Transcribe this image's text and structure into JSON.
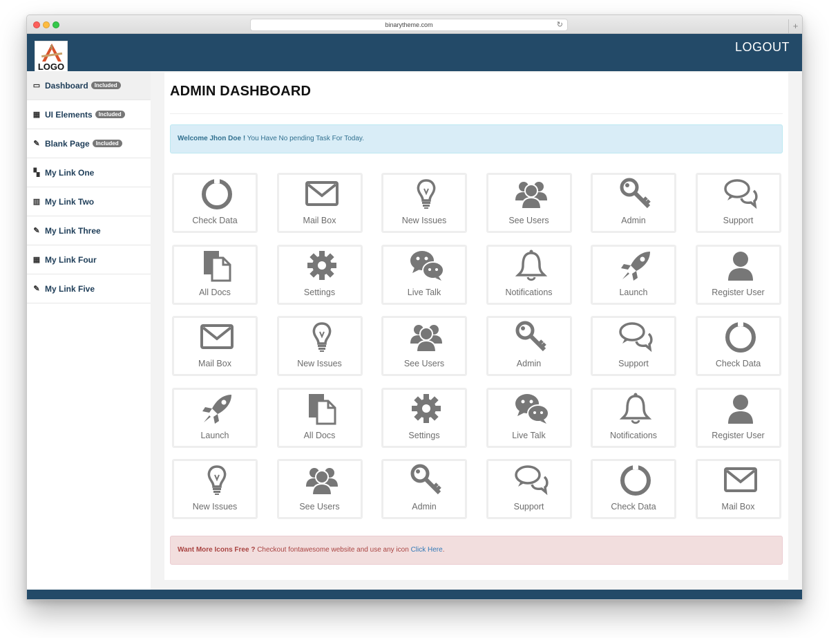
{
  "browser": {
    "url": "binarytheme.com"
  },
  "header": {
    "logo_text": "LOGO",
    "logout_label": "LOGOUT"
  },
  "sidebar": {
    "items": [
      {
        "label": "Dashboard",
        "icon": "desktop-icon",
        "glyph": "▭",
        "badge": "Included",
        "active": true
      },
      {
        "label": "UI Elements",
        "icon": "table-icon",
        "glyph": "▦",
        "badge": "Included"
      },
      {
        "label": "Blank Page",
        "icon": "edit-icon",
        "glyph": "✎",
        "badge": "Included"
      },
      {
        "label": "My Link One",
        "icon": "qrcode-icon",
        "glyph": "▚"
      },
      {
        "label": "My Link Two",
        "icon": "bar-chart-icon",
        "glyph": "▥"
      },
      {
        "label": "My Link Three",
        "icon": "edit-icon",
        "glyph": "✎"
      },
      {
        "label": "My Link Four",
        "icon": "table-icon",
        "glyph": "▦"
      },
      {
        "label": "My Link Five",
        "icon": "edit-icon",
        "glyph": "✎"
      }
    ]
  },
  "main": {
    "title": "ADMIN DASHBOARD",
    "welcome": {
      "strong": "Welcome Jhon Doe !",
      "text": "You Have No pending Task For Today."
    },
    "tiles": [
      {
        "label": "Check Data",
        "icon": "circle-notch-icon"
      },
      {
        "label": "Mail Box",
        "icon": "envelope-icon"
      },
      {
        "label": "New Issues",
        "icon": "lightbulb-icon"
      },
      {
        "label": "See Users",
        "icon": "users-icon"
      },
      {
        "label": "Admin",
        "icon": "key-icon"
      },
      {
        "label": "Support",
        "icon": "comments-icon"
      },
      {
        "label": "All Docs",
        "icon": "files-icon"
      },
      {
        "label": "Settings",
        "icon": "gear-icon"
      },
      {
        "label": "Live Talk",
        "icon": "wechat-icon"
      },
      {
        "label": "Notifications",
        "icon": "bell-icon"
      },
      {
        "label": "Launch",
        "icon": "rocket-icon"
      },
      {
        "label": "Register User",
        "icon": "user-icon"
      },
      {
        "label": "Mail Box",
        "icon": "envelope-icon"
      },
      {
        "label": "New Issues",
        "icon": "lightbulb-icon"
      },
      {
        "label": "See Users",
        "icon": "users-icon"
      },
      {
        "label": "Admin",
        "icon": "key-icon"
      },
      {
        "label": "Support",
        "icon": "comments-icon"
      },
      {
        "label": "Check Data",
        "icon": "circle-notch-icon"
      },
      {
        "label": "Launch",
        "icon": "rocket-icon"
      },
      {
        "label": "All Docs",
        "icon": "files-icon"
      },
      {
        "label": "Settings",
        "icon": "gear-icon"
      },
      {
        "label": "Live Talk",
        "icon": "wechat-icon"
      },
      {
        "label": "Notifications",
        "icon": "bell-icon"
      },
      {
        "label": "Register User",
        "icon": "user-icon"
      },
      {
        "label": "New Issues",
        "icon": "lightbulb-icon"
      },
      {
        "label": "See Users",
        "icon": "users-icon"
      },
      {
        "label": "Admin",
        "icon": "key-icon"
      },
      {
        "label": "Support",
        "icon": "comments-icon"
      },
      {
        "label": "Check Data",
        "icon": "circle-notch-icon"
      },
      {
        "label": "Mail Box",
        "icon": "envelope-icon"
      }
    ],
    "more_icons": {
      "strong": "Want More Icons Free ?",
      "text": "Checkout fontawesome website and use any icon",
      "link": "Click Here",
      "trailing": "."
    }
  },
  "colors": {
    "header": "#234a68",
    "icon": "#777777",
    "nav_text": "#1e3d58"
  }
}
